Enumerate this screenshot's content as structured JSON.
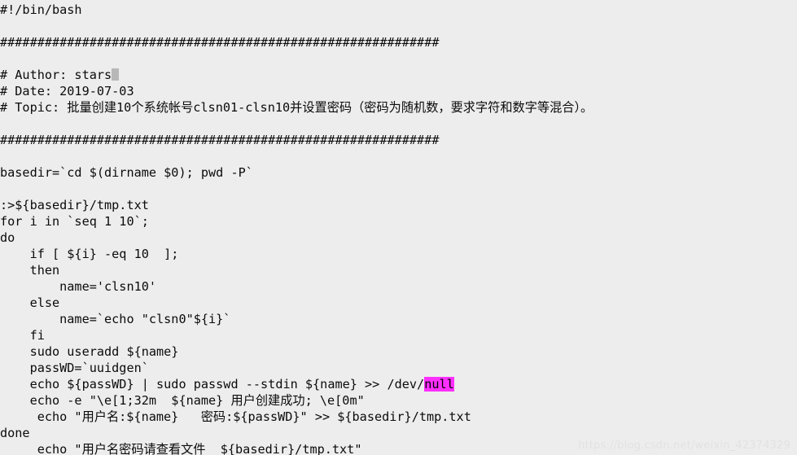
{
  "editor": {
    "background_color": "#ededed",
    "text_color": "#0b0b0b",
    "highlight_color": "#ff2fff",
    "cursor_color": "#b8b8b8",
    "lines": [
      {
        "text": "#!/bin/bash"
      },
      {
        "text": ""
      },
      {
        "text": "###########################################################"
      },
      {
        "text": ""
      },
      {
        "text": "# Author: stars",
        "cursor_after": true
      },
      {
        "text": "# Date: 2019-07-03"
      },
      {
        "text": "# Topic: 批量创建10个系统帐号clsn01-clsn10并设置密码（密码为随机数，要求字符和数字等混合）。"
      },
      {
        "text": ""
      },
      {
        "text": "###########################################################"
      },
      {
        "text": ""
      },
      {
        "text": "basedir=`cd $(dirname $0); pwd -P`"
      },
      {
        "text": ""
      },
      {
        "text": ":>${basedir}/tmp.txt"
      },
      {
        "text": "for i in `seq 1 10`;"
      },
      {
        "text": "do"
      },
      {
        "text": "    if [ ${i} -eq 10  ];"
      },
      {
        "text": "    then"
      },
      {
        "text": "        name='clsn10'"
      },
      {
        "text": "    else"
      },
      {
        "text": "        name=`echo \"clsn0\"${i}`"
      },
      {
        "text": "    fi"
      },
      {
        "text": "    sudo useradd ${name}"
      },
      {
        "text": "    passWD=`uuidgen`"
      },
      {
        "text": "    echo ${passWD} | sudo passwd --stdin ${name} >> /dev/",
        "highlight": "null",
        "text_after": ""
      },
      {
        "text": "    echo -e \"\\e[1;32m  ${name} 用户创建成功; \\e[0m\""
      },
      {
        "text": "     echo \"用户名:${name}   密码:${passWD}\" >> ${basedir}/tmp.txt"
      },
      {
        "text": "done"
      },
      {
        "text": "     echo \"用户名密码请查看文件  ${basedir}/tmp.txt\""
      }
    ]
  },
  "watermark": {
    "text": "https://blog.csdn.net/weixin_42374329"
  }
}
